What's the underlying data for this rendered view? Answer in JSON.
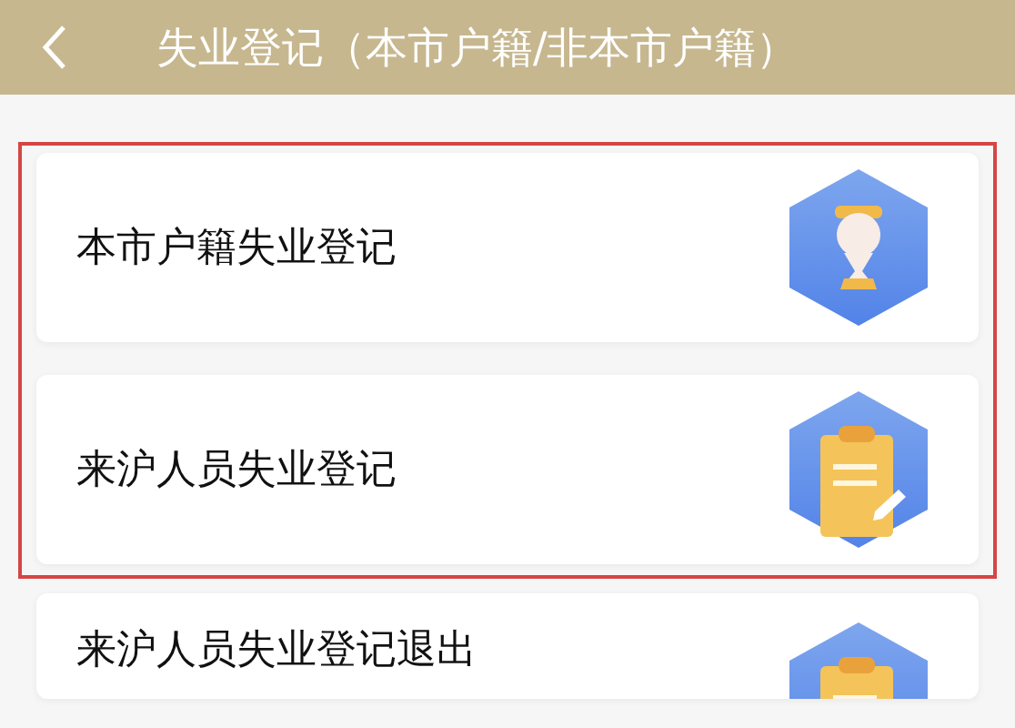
{
  "header": {
    "title": "失业登记（本市户籍/非本市户籍）"
  },
  "items": [
    {
      "label": "本市户籍失业登记",
      "kind": "person",
      "highlighted": true
    },
    {
      "label": "来沪人员失业登记",
      "kind": "clipboard",
      "highlighted": true
    },
    {
      "label": "来沪人员失业登记退出",
      "kind": "clipboard",
      "highlighted": false
    }
  ]
}
